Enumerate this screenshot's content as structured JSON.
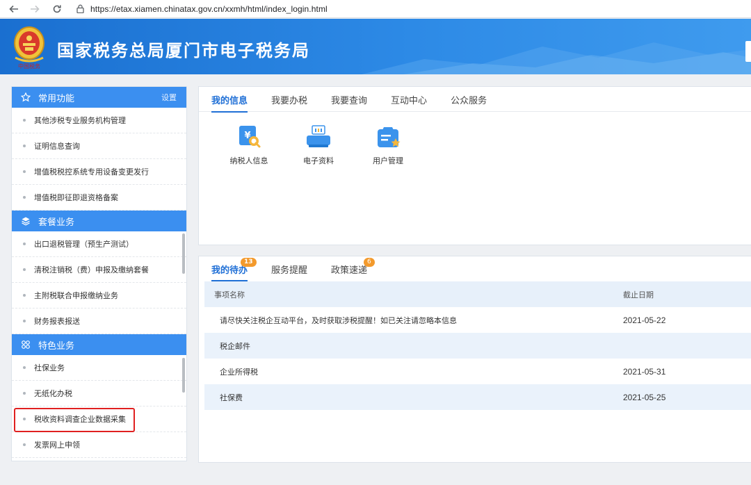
{
  "browser": {
    "url": "https://etax.xiamen.chinatax.gov.cn/xxmh/html/index_login.html"
  },
  "header": {
    "title": "国家税务总局厦门市电子税务局",
    "emblem_text": "中国税务"
  },
  "sidebar": {
    "common": {
      "title": "常用功能",
      "settings_label": "设置",
      "items": [
        {
          "label": "其他涉税专业服务机构管理"
        },
        {
          "label": "证明信息查询"
        },
        {
          "label": "增值税税控系统专用设备变更发行"
        },
        {
          "label": "增值税即征即退资格备案"
        }
      ]
    },
    "package": {
      "title": "套餐业务",
      "items": [
        {
          "label": "出口退税管理（预生产测试）"
        },
        {
          "label": "清税注销税（费）申报及缴纳套餐"
        },
        {
          "label": "主附税联合申报缴纳业务"
        },
        {
          "label": "财务报表报送"
        }
      ]
    },
    "special": {
      "title": "特色业务",
      "items": [
        {
          "label": "社保业务"
        },
        {
          "label": "无纸化办税"
        },
        {
          "label": "税收资料调查企业数据采集"
        },
        {
          "label": "发票网上申领"
        }
      ]
    }
  },
  "main": {
    "tabs": [
      {
        "label": "我的信息"
      },
      {
        "label": "我要办税"
      },
      {
        "label": "我要查询"
      },
      {
        "label": "互动中心"
      },
      {
        "label": "公众服务"
      }
    ],
    "apps": [
      {
        "label": "纳税人信息",
        "icon": "taxpayer-info-icon"
      },
      {
        "label": "电子资料",
        "icon": "electronic-docs-icon"
      },
      {
        "label": "用户管理",
        "icon": "user-management-icon"
      }
    ]
  },
  "todo": {
    "tabs": [
      {
        "label": "我的待办",
        "badge": "13"
      },
      {
        "label": "服务提醒"
      },
      {
        "label": "政策速递",
        "badge": "6"
      }
    ],
    "columns": {
      "name": "事项名称",
      "deadline": "截止日期"
    },
    "rows": [
      {
        "name": "请尽快关注税企互动平台，及时获取涉税提醒！如已关注请忽略本信息",
        "deadline": "2021-05-22"
      },
      {
        "name": "税企邮件",
        "deadline": ""
      },
      {
        "name": "企业所得税",
        "deadline": "2021-05-31"
      },
      {
        "name": "社保费",
        "deadline": "2021-05-25"
      }
    ]
  },
  "colors": {
    "accent": "#3b8ff0",
    "highlight": "#e02020",
    "badge": "#f39a2c"
  }
}
